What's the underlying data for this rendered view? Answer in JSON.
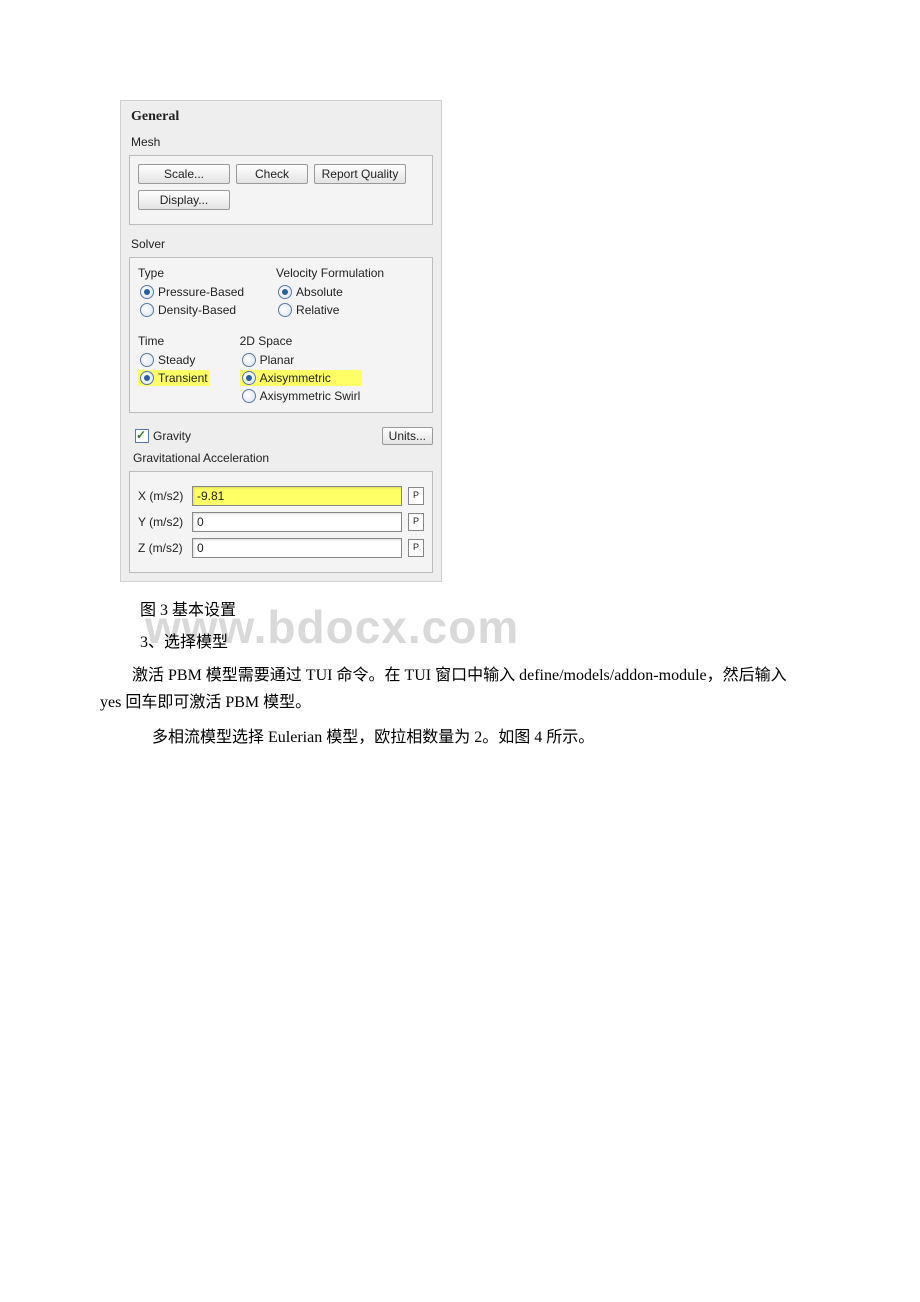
{
  "panel": {
    "title": "General",
    "mesh_label": "Mesh",
    "buttons": {
      "scale": "Scale...",
      "check": "Check",
      "report": "Report Quality",
      "display": "Display..."
    },
    "solver_label": "Solver",
    "type": {
      "title": "Type",
      "pressure": "Pressure-Based",
      "density": "Density-Based"
    },
    "velocity": {
      "title": "Velocity Formulation",
      "absolute": "Absolute",
      "relative": "Relative"
    },
    "time": {
      "title": "Time",
      "steady": "Steady",
      "transient": "Transient"
    },
    "space": {
      "title": "2D Space",
      "planar": "Planar",
      "axi": "Axisymmetric",
      "axiswirl": "Axisymmetric Swirl"
    },
    "gravity_label": "Gravity",
    "units_btn": "Units...",
    "grav_accel_label": "Gravitational Acceleration",
    "fields": {
      "x_label": "X (m/s2)",
      "x_val": "-9.81",
      "y_label": "Y (m/s2)",
      "y_val": "0",
      "z_label": "Z (m/s2)",
      "z_val": "0",
      "p": "P"
    }
  },
  "doc": {
    "caption": "图 3 基本设置",
    "heading": "3、选择模型",
    "para1": "激活 PBM 模型需要通过 TUI 命令。在 TUI 窗口中输入 define/models/addon-module，然后输入 yes 回车即可激活 PBM 模型。",
    "para2": "多相流模型选择 Eulerian 模型，欧拉相数量为 2。如图 4 所示。",
    "watermark": "www.bdocx.com"
  }
}
